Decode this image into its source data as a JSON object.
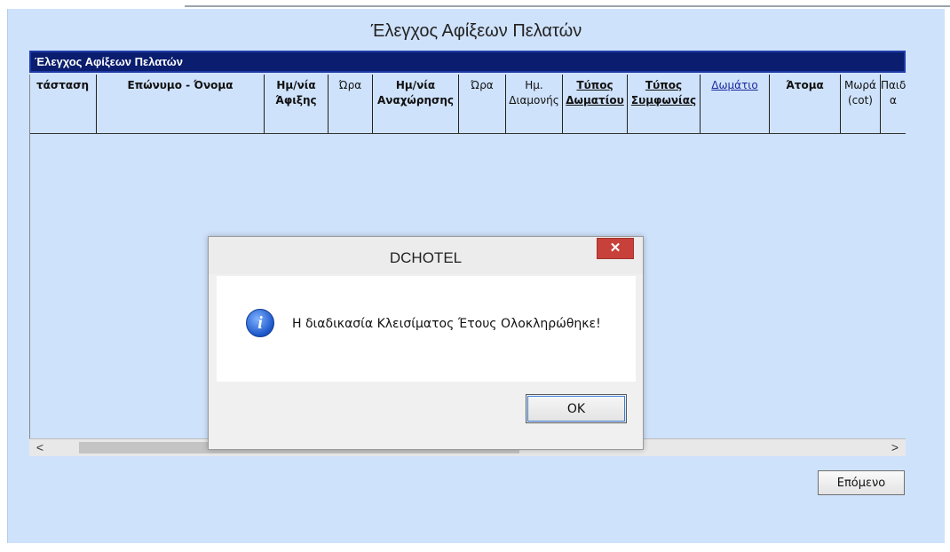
{
  "window": {
    "title": "Έλεγχος Αφίξεων Πελατών"
  },
  "grid": {
    "title": "Έλεγχος Αφίξεων Πελατών",
    "columns": [
      {
        "label": "τάσταση",
        "style": "bold"
      },
      {
        "label": "Επώνυμο - Όνομα",
        "style": "bold"
      },
      {
        "label": "Ημ/νία\nΆφιξης",
        "style": "bold"
      },
      {
        "label": "Ώρα",
        "style": "normal"
      },
      {
        "label": "Ημ/νία\nΑναχώρησης",
        "style": "bold"
      },
      {
        "label": "Ώρα",
        "style": "normal"
      },
      {
        "label": "Ημ.\nΔιαμονής",
        "style": "normal"
      },
      {
        "label": "Τύπος\nΔωματίου",
        "style": "bold-link"
      },
      {
        "label": "Τύπος\nΣυμφωνίας",
        "style": "bold-link"
      },
      {
        "label": "Δωμάτιο",
        "style": "link"
      },
      {
        "label": "Άτομα",
        "style": "bold"
      },
      {
        "label": "Μωρά\n(cot)",
        "style": "normal"
      },
      {
        "label": "Παιδι\nα",
        "style": "normal"
      }
    ],
    "rows": []
  },
  "scrollbar": {
    "left_arrow": "<",
    "right_arrow": ">"
  },
  "buttons": {
    "next": "Επόμενο"
  },
  "dialog": {
    "title": "DCHOTEL",
    "close_glyph": "✕",
    "icon": "info-icon",
    "icon_glyph": "i",
    "message": "Η διαδικασία Κλεισίματος Έτους Ολοκληρώθηκε!",
    "ok_label": "OK"
  },
  "colors": {
    "window_bg": "#cfe2fb",
    "grid_title_bg": "#0a1d6e",
    "close_button": "#c7413a"
  }
}
